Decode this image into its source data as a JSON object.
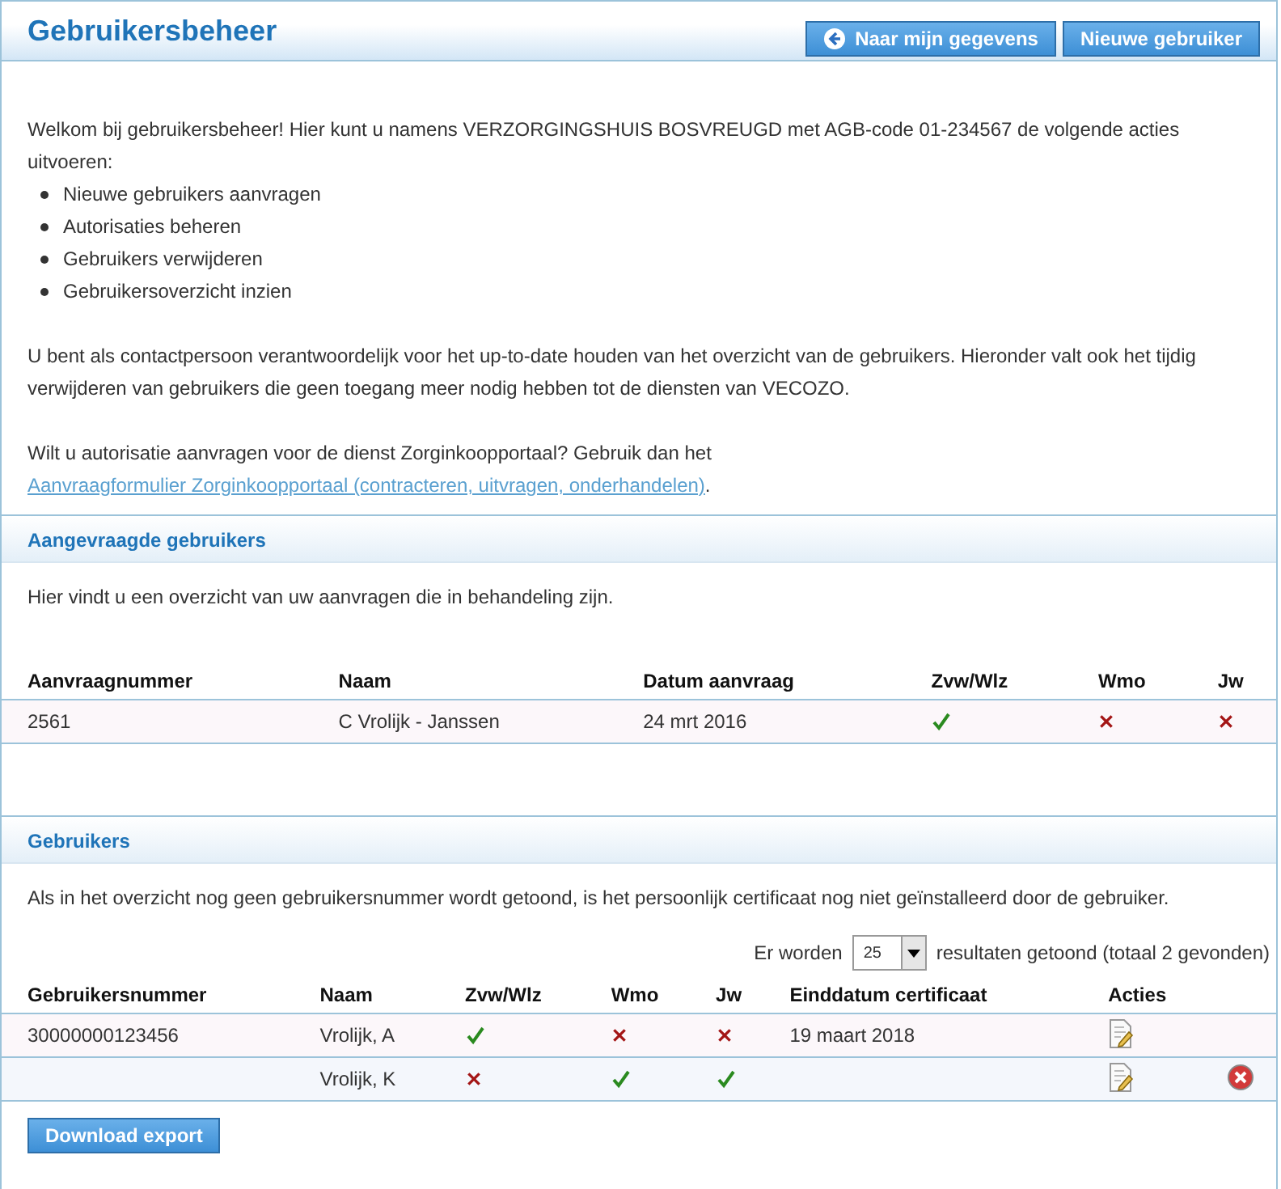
{
  "header": {
    "title": "Gebruikersbeheer",
    "buttons": [
      {
        "label": "Naar mijn gegevens",
        "kind": "back"
      },
      {
        "label": "Nieuwe gebruiker",
        "kind": "plain"
      }
    ]
  },
  "intro": {
    "text": "Welkom bij gebruikersbeheer! Hier kunt u namens VERZORGINGSHUIS BOSVREUGD met AGB-code 01-234567 de volgende acties uitvoeren:",
    "bullets": [
      "Nieuwe gebruikers aanvragen",
      "Autorisaties beheren",
      "Gebruikers verwijderen",
      "Gebruikersoverzicht inzien"
    ],
    "paragraph": "U bent als contactpersoon verantwoordelijk voor het up-to-date houden van het overzicht van de gebruikers. Hieronder valt ook het tijdig verwijderen van gebruikers die geen toegang meer nodig hebben tot de diensten van VECOZO.",
    "link_before": "Wilt u autorisatie aanvragen voor de dienst Zorginkoopportaal? Gebruik dan het",
    "link": "Aanvraagformulier Zorginkoopportaal (contracteren, uitvragen, onderhandelen)",
    "link_after": "."
  },
  "requests": {
    "title": "Aangevraagde gebruikers",
    "text": "Hier vindt u een overzicht van uw aanvragen die in behandeling zijn.",
    "columns": [
      "Aanvraagnummer",
      "Naam",
      "Datum aanvraag",
      "Zvw/Wlz",
      "Wmo",
      "Jw"
    ],
    "rows": [
      {
        "number": "2561",
        "name": "C Vrolijk - Janssen",
        "date": "24 mrt 2016",
        "zvw_wlz": true,
        "wmo": false,
        "jw": false
      }
    ]
  },
  "users": {
    "title": "Gebruikers",
    "text": "Als in het overzicht nog geen gebruikersnummer wordt getoond, is het persoonlijk certificaat nog niet geïnstalleerd door de gebruiker.",
    "paging_before": "Er worden",
    "page_size": "25",
    "paging_after": "resultaten getoond (totaal 2 gevonden)",
    "columns": [
      "Gebruikersnummer",
      "Naam",
      "Zvw/Wlz",
      "Wmo",
      "Jw",
      "Einddatum certificaat",
      "Acties"
    ],
    "rows": [
      {
        "number": "30000000123456",
        "name": "Vrolijk, A",
        "zvw_wlz": true,
        "wmo": false,
        "jw": false,
        "end_date": "19 maart 2018",
        "deletable": false
      },
      {
        "name": "Vrolijk, K",
        "zvw_wlz": false,
        "wmo": true,
        "jw": true,
        "deletable": true
      }
    ],
    "export_button": "Download export"
  }
}
